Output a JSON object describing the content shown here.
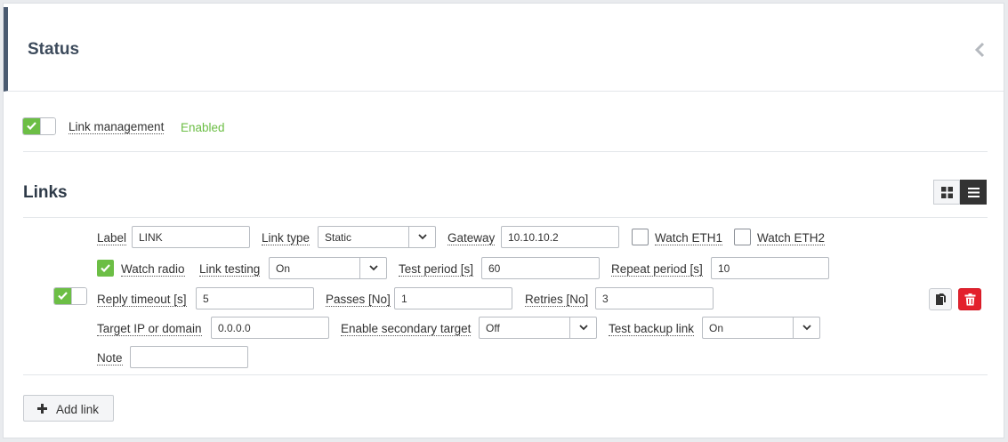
{
  "status": {
    "title": "Status"
  },
  "link_management": {
    "label": "Link management",
    "state_text": "Enabled",
    "enabled": true
  },
  "links": {
    "title": "Links",
    "add_label": "Add link",
    "row": {
      "enabled": true,
      "label": {
        "label": "Label",
        "value": "LINK"
      },
      "link_type": {
        "label": "Link type",
        "value": "Static"
      },
      "gateway": {
        "label": "Gateway",
        "value": "10.10.10.2"
      },
      "watch_eth1": {
        "label": "Watch ETH1",
        "checked": false
      },
      "watch_eth2": {
        "label": "Watch ETH2",
        "checked": false
      },
      "watch_radio": {
        "label": "Watch radio",
        "checked": true
      },
      "link_testing": {
        "label": "Link testing",
        "value": "On"
      },
      "test_period": {
        "label": "Test period [s]",
        "value": "60"
      },
      "repeat_period": {
        "label": "Repeat period [s]",
        "value": "10"
      },
      "reply_timeout": {
        "label": "Reply timeout [s]",
        "value": "5"
      },
      "passes": {
        "label": "Passes [No]",
        "value": "1"
      },
      "retries": {
        "label": "Retries [No]",
        "value": "3"
      },
      "target": {
        "label": "Target IP or domain",
        "value": "0.0.0.0"
      },
      "secondary_target": {
        "label": "Enable secondary target",
        "value": "Off"
      },
      "test_backup": {
        "label": "Test backup link",
        "value": "On"
      },
      "note": {
        "label": "Note",
        "value": ""
      }
    }
  },
  "colors": {
    "accent_green": "#6cbe45",
    "danger_red": "#e3202c",
    "header_bar": "#4a5a70"
  }
}
